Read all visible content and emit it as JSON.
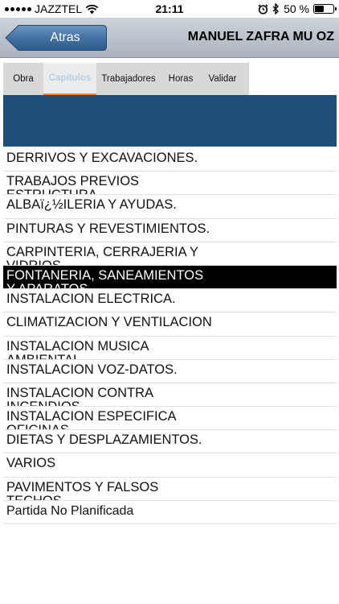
{
  "status_bar": {
    "carrier": "JAZZTEL",
    "time": "21:11",
    "battery_percent": "50 %",
    "icons": [
      "signal-icon",
      "wifi-icon",
      "alarm-icon",
      "bluetooth-icon",
      "battery-icon"
    ]
  },
  "nav": {
    "back_label": "Atras",
    "title": "MANUEL ZAFRA MU OZ"
  },
  "tabs": [
    {
      "label": "Obra",
      "active": false
    },
    {
      "label": "Capitulos",
      "active": true
    },
    {
      "label": "Trabajadores",
      "active": false
    },
    {
      "label": "Horas",
      "active": false
    },
    {
      "label": "Validar",
      "active": false
    }
  ],
  "colors": {
    "banner": "#1f4e7a",
    "active_tab_underline": "#f08a2c",
    "selected_row": "#000000",
    "back_button": "#3f6a98"
  },
  "list": {
    "selected_index": 5,
    "items": [
      "DERRIVOS Y EXCAVACIONES.",
      "TRABAJOS PREVIOS\nESTRUCTURA",
      "ALBAï¿½ILERIA Y AYUDAS.",
      "PINTURAS Y REVESTIMIENTOS.",
      "CARPINTERIA, CERRAJERIA Y\nVIDRIOS.",
      "FONTANERIA, SANEAMIENTOS\nY APARATOS",
      "INSTALACION ELECTRICA.",
      "CLIMATIZACION Y VENTILACION",
      "INSTALACION MUSICA\nAMBIENTAL",
      "INSTALACION VOZ-DATOS.",
      "INSTALACION CONTRA\nINCENDIOS.",
      "INSTALACION ESPECIFICA\nOFICINAS",
      "DIETAS Y DESPLAZAMIENTOS.",
      "VARIOS",
      "PAVIMENTOS Y FALSOS\nTECHOS",
      "Partida No Planificada"
    ]
  }
}
